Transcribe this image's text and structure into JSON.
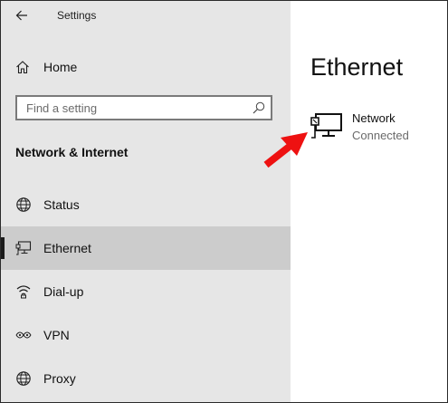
{
  "window": {
    "title": "Settings"
  },
  "sidebar": {
    "home_label": "Home",
    "search": {
      "placeholder": "Find a setting",
      "value": ""
    },
    "section_heading": "Network & Internet",
    "items": [
      {
        "label": "Status",
        "icon": "globe-icon",
        "selected": false
      },
      {
        "label": "Ethernet",
        "icon": "ethernet-icon",
        "selected": true
      },
      {
        "label": "Dial-up",
        "icon": "dial-up-icon",
        "selected": false
      },
      {
        "label": "VPN",
        "icon": "vpn-icon",
        "selected": false
      },
      {
        "label": "Proxy",
        "icon": "proxy-globe-icon",
        "selected": false
      }
    ]
  },
  "content": {
    "page_title": "Ethernet",
    "network": {
      "name": "Network",
      "status": "Connected",
      "icon": "ethernet-network-icon"
    }
  },
  "annotation": {
    "color": "#ee1111"
  },
  "colors": {
    "sidebar_bg": "#e6e6e6",
    "selected_bg": "#cccccc",
    "content_bg": "#ffffff"
  }
}
